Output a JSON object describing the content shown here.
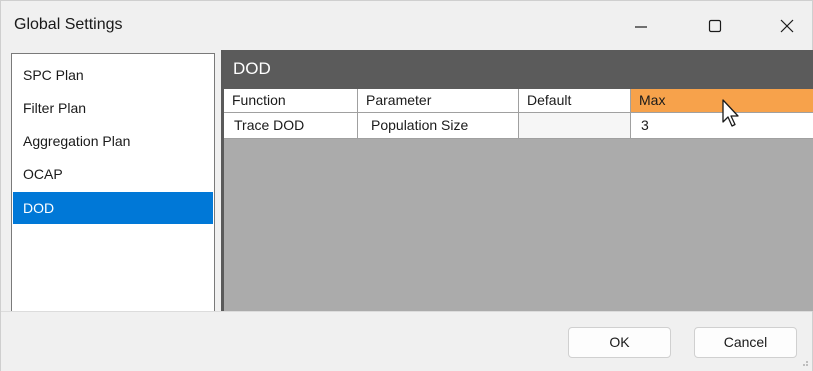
{
  "window": {
    "title": "Global Settings"
  },
  "titlebar_icons": [
    "minimize-icon",
    "maximize-icon",
    "close-icon"
  ],
  "sidebar": {
    "items": [
      {
        "label": "SPC Plan",
        "selected": false
      },
      {
        "label": "Filter Plan",
        "selected": false
      },
      {
        "label": "Aggregation Plan",
        "selected": false
      },
      {
        "label": "OCAP",
        "selected": false
      },
      {
        "label": "DOD",
        "selected": true
      }
    ]
  },
  "panel": {
    "title": "DOD",
    "columns": [
      "Function",
      "Parameter",
      "Default",
      "Max"
    ],
    "hovered_column": "Max",
    "rows": [
      {
        "function": "Trace DOD",
        "parameter": "Population Size",
        "default": "",
        "max": "3"
      }
    ]
  },
  "footer": {
    "ok_label": "OK",
    "cancel_label": "Cancel"
  },
  "colors": {
    "selection": "#0078d7",
    "panel_header": "#5b5b5b",
    "hover_header": "#f7a24b",
    "grid_background": "#ababab"
  }
}
